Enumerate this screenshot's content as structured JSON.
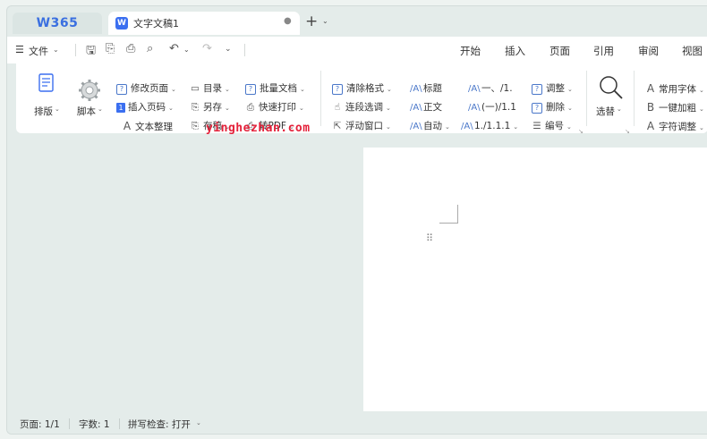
{
  "tabs": {
    "logo": "W365",
    "doc_badge": "W",
    "doc_title": "文字文稿1",
    "doc_dot": "●",
    "new_tab": "+",
    "new_tab_chev": "⌄"
  },
  "menubar": {
    "file": "文件",
    "file_icon": "☰",
    "tabs": [
      "开始",
      "插入",
      "页面",
      "引用",
      "审阅",
      "视图"
    ]
  },
  "ribbon": {
    "layout": "排版",
    "script": "脚本",
    "edit_page": "修改页面",
    "insert_page_num": "插入页码",
    "text_tidy": "文本整理",
    "toc": "目录",
    "save_as": "另存",
    "save_draft": "存稿",
    "batch_doc": "批量文档",
    "quick_print": "快速打印",
    "to_pdf": "转PDF",
    "clear_format": "清除格式",
    "para_select": "连段选调",
    "float_window": "浮动窗口",
    "style_title": "标题",
    "style_body": "正文",
    "style_auto": "自动",
    "num_1": "一、/1.",
    "num_2": "(一)/1.1",
    "num_3": "1./1.1.1",
    "adjust": "调整",
    "delete": "删除",
    "numbering": "编号",
    "select": "选替",
    "common_font": "常用字体",
    "one_click_bold": "一键加粗",
    "char_adjust": "字符调整"
  },
  "watermark": "yinghezhan.com",
  "status": {
    "page": "页面: 1/1",
    "words": "字数: 1",
    "spell": "拼写检查: 打开"
  },
  "colors": {
    "accent": "#3a6fe0",
    "watermark": "#e4213a",
    "background": "#e4ecea"
  }
}
